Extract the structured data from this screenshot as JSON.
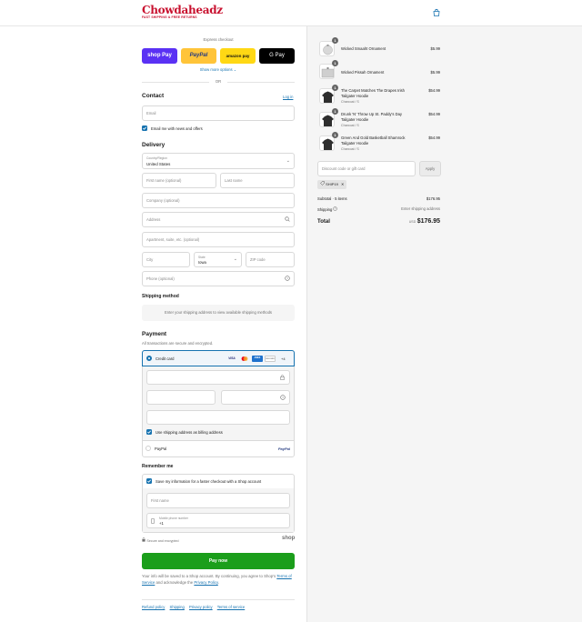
{
  "header": {
    "logo_main": "Chowdaheadz",
    "logo_sub": "FAST SHIPPING & FREE RETURNS",
    "cart_icon": "shopping-bag-icon"
  },
  "express": {
    "title": "Express checkout",
    "shop_pay": "shop Pay",
    "paypal": "PayPal",
    "amazon_pay": "amazon pay",
    "google_pay": "G Pay",
    "show_more": "Show more options",
    "or": "OR"
  },
  "contact": {
    "heading": "Contact",
    "login": "Log in",
    "email_placeholder": "Email",
    "news_label": "Email me with news and offers"
  },
  "delivery": {
    "heading": "Delivery",
    "country_label": "Country/Region",
    "country_value": "United States",
    "first_name": "First name (optional)",
    "last_name": "Last name",
    "company": "Company (optional)",
    "address": "Address",
    "apartment": "Apartment, suite, etc. (optional)",
    "city": "City",
    "state_label": "State",
    "state_value": "Iowa",
    "zip": "ZIP code",
    "phone": "Phone (optional)"
  },
  "shipping_method": {
    "heading": "Shipping method",
    "message": "Enter your shipping address to view available shipping methods"
  },
  "payment": {
    "heading": "Payment",
    "subtitle": "All transactions are secure and encrypted.",
    "credit_card": "Credit card",
    "card_brands": [
      "VISA",
      "MC",
      "AMEX",
      "DISCOVER"
    ],
    "more_cards": "+4",
    "billing_label": "Use shipping address as billing address",
    "paypal": "PayPal",
    "paypal_logo": "PayPal"
  },
  "remember": {
    "heading": "Remember me",
    "save_label": "Save my information for a faster checkout with a Shop account",
    "first_name": "First name",
    "mobile_label": "Mobile phone number",
    "mobile_value": "+1",
    "secure": "Secure and encrypted",
    "shop": "shop"
  },
  "pay_now": "Pay now",
  "legal": {
    "text1": "Your info will be saved to a Shop account. By continuing, you agree to Shop’s",
    "terms": "Terms of Service",
    "text2": "and acknowledge the",
    "privacy": "Privacy Policy",
    "text3": "."
  },
  "footer_links": [
    "Refund policy",
    "Shipping",
    "Privacy policy",
    "Terms of service"
  ],
  "order": {
    "items": [
      {
        "qty": "1",
        "name": "Wicked Smaaht Ornament",
        "variant": "",
        "price": "$5.99"
      },
      {
        "qty": "1",
        "name": "Wicked Pissah Ornament",
        "variant": "",
        "price": "$5.99"
      },
      {
        "qty": "1",
        "name": "The Carpet Matches The Drapes Irish Tailgater Hoodie",
        "variant": "Charcoal / S",
        "price": "$54.99"
      },
      {
        "qty": "1",
        "name": "Drunk 'N' Throw Up St. Paddy's Day Tailgater Hoodie",
        "variant": "Charcoal / S",
        "price": "$54.99"
      },
      {
        "qty": "1",
        "name": "Green And Gold Basketball Shamrock Tailgater Hoodie",
        "variant": "Charcoal / S",
        "price": "$54.99"
      }
    ],
    "discount_placeholder": "Discount code or gift card",
    "apply": "Apply",
    "discount_tag": "SHIP19",
    "subtotal_label": "Subtotal · 5 items",
    "subtotal_value": "$176.95",
    "shipping_label": "Shipping",
    "shipping_value": "Enter shipping address",
    "total_label": "Total",
    "currency": "USD",
    "total_value": "$176.95"
  }
}
